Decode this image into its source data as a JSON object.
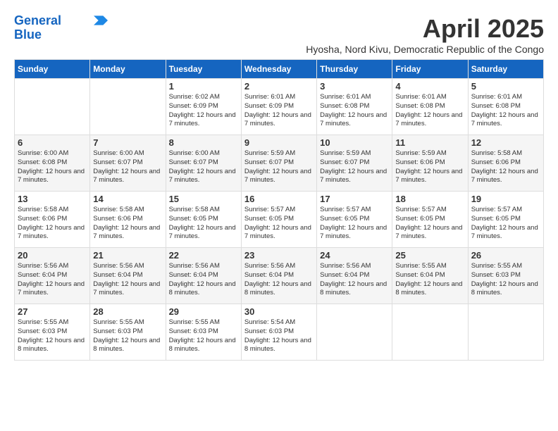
{
  "logo": {
    "line1": "General",
    "line2": "Blue"
  },
  "header": {
    "title": "April 2025",
    "subtitle": "Hyosha, Nord Kivu, Democratic Republic of the Congo"
  },
  "weekdays": [
    "Sunday",
    "Monday",
    "Tuesday",
    "Wednesday",
    "Thursday",
    "Friday",
    "Saturday"
  ],
  "weeks": [
    [
      {
        "day": "",
        "info": ""
      },
      {
        "day": "",
        "info": ""
      },
      {
        "day": "1",
        "info": "Sunrise: 6:02 AM\nSunset: 6:09 PM\nDaylight: 12 hours and 7 minutes."
      },
      {
        "day": "2",
        "info": "Sunrise: 6:01 AM\nSunset: 6:09 PM\nDaylight: 12 hours and 7 minutes."
      },
      {
        "day": "3",
        "info": "Sunrise: 6:01 AM\nSunset: 6:08 PM\nDaylight: 12 hours and 7 minutes."
      },
      {
        "day": "4",
        "info": "Sunrise: 6:01 AM\nSunset: 6:08 PM\nDaylight: 12 hours and 7 minutes."
      },
      {
        "day": "5",
        "info": "Sunrise: 6:01 AM\nSunset: 6:08 PM\nDaylight: 12 hours and 7 minutes."
      }
    ],
    [
      {
        "day": "6",
        "info": "Sunrise: 6:00 AM\nSunset: 6:08 PM\nDaylight: 12 hours and 7 minutes."
      },
      {
        "day": "7",
        "info": "Sunrise: 6:00 AM\nSunset: 6:07 PM\nDaylight: 12 hours and 7 minutes."
      },
      {
        "day": "8",
        "info": "Sunrise: 6:00 AM\nSunset: 6:07 PM\nDaylight: 12 hours and 7 minutes."
      },
      {
        "day": "9",
        "info": "Sunrise: 5:59 AM\nSunset: 6:07 PM\nDaylight: 12 hours and 7 minutes."
      },
      {
        "day": "10",
        "info": "Sunrise: 5:59 AM\nSunset: 6:07 PM\nDaylight: 12 hours and 7 minutes."
      },
      {
        "day": "11",
        "info": "Sunrise: 5:59 AM\nSunset: 6:06 PM\nDaylight: 12 hours and 7 minutes."
      },
      {
        "day": "12",
        "info": "Sunrise: 5:58 AM\nSunset: 6:06 PM\nDaylight: 12 hours and 7 minutes."
      }
    ],
    [
      {
        "day": "13",
        "info": "Sunrise: 5:58 AM\nSunset: 6:06 PM\nDaylight: 12 hours and 7 minutes."
      },
      {
        "day": "14",
        "info": "Sunrise: 5:58 AM\nSunset: 6:06 PM\nDaylight: 12 hours and 7 minutes."
      },
      {
        "day": "15",
        "info": "Sunrise: 5:58 AM\nSunset: 6:05 PM\nDaylight: 12 hours and 7 minutes."
      },
      {
        "day": "16",
        "info": "Sunrise: 5:57 AM\nSunset: 6:05 PM\nDaylight: 12 hours and 7 minutes."
      },
      {
        "day": "17",
        "info": "Sunrise: 5:57 AM\nSunset: 6:05 PM\nDaylight: 12 hours and 7 minutes."
      },
      {
        "day": "18",
        "info": "Sunrise: 5:57 AM\nSunset: 6:05 PM\nDaylight: 12 hours and 7 minutes."
      },
      {
        "day": "19",
        "info": "Sunrise: 5:57 AM\nSunset: 6:05 PM\nDaylight: 12 hours and 7 minutes."
      }
    ],
    [
      {
        "day": "20",
        "info": "Sunrise: 5:56 AM\nSunset: 6:04 PM\nDaylight: 12 hours and 7 minutes."
      },
      {
        "day": "21",
        "info": "Sunrise: 5:56 AM\nSunset: 6:04 PM\nDaylight: 12 hours and 7 minutes."
      },
      {
        "day": "22",
        "info": "Sunrise: 5:56 AM\nSunset: 6:04 PM\nDaylight: 12 hours and 8 minutes."
      },
      {
        "day": "23",
        "info": "Sunrise: 5:56 AM\nSunset: 6:04 PM\nDaylight: 12 hours and 8 minutes."
      },
      {
        "day": "24",
        "info": "Sunrise: 5:56 AM\nSunset: 6:04 PM\nDaylight: 12 hours and 8 minutes."
      },
      {
        "day": "25",
        "info": "Sunrise: 5:55 AM\nSunset: 6:04 PM\nDaylight: 12 hours and 8 minutes."
      },
      {
        "day": "26",
        "info": "Sunrise: 5:55 AM\nSunset: 6:03 PM\nDaylight: 12 hours and 8 minutes."
      }
    ],
    [
      {
        "day": "27",
        "info": "Sunrise: 5:55 AM\nSunset: 6:03 PM\nDaylight: 12 hours and 8 minutes."
      },
      {
        "day": "28",
        "info": "Sunrise: 5:55 AM\nSunset: 6:03 PM\nDaylight: 12 hours and 8 minutes."
      },
      {
        "day": "29",
        "info": "Sunrise: 5:55 AM\nSunset: 6:03 PM\nDaylight: 12 hours and 8 minutes."
      },
      {
        "day": "30",
        "info": "Sunrise: 5:54 AM\nSunset: 6:03 PM\nDaylight: 12 hours and 8 minutes."
      },
      {
        "day": "",
        "info": ""
      },
      {
        "day": "",
        "info": ""
      },
      {
        "day": "",
        "info": ""
      }
    ]
  ]
}
